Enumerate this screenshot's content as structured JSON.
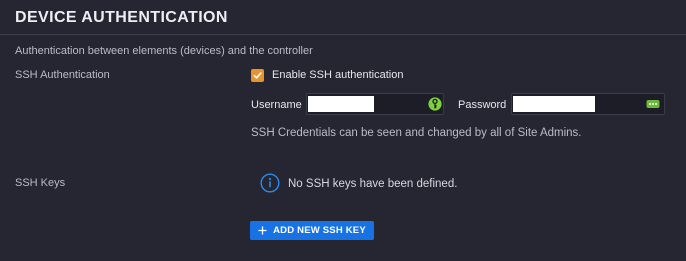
{
  "section": {
    "title": "DEVICE AUTHENTICATION",
    "subtitle": "Authentication between elements (devices) and the controller"
  },
  "ssh_auth": {
    "label": "SSH Authentication",
    "checkbox_label": "Enable SSH authentication",
    "checked": true,
    "checkbox_color": "#e8942c",
    "username_label": "Username",
    "username_value": "",
    "password_label": "Password",
    "password_value": "",
    "username_icon": "key-icon",
    "password_icon": "show-password-icon",
    "note": "SSH Credentials can be seen and changed by all of Site Admins."
  },
  "ssh_keys": {
    "label": "SSH Keys",
    "empty_text": "No SSH keys have been defined.",
    "info_icon": "info-icon",
    "add_button_label": "ADD NEW SSH KEY",
    "add_button_color": "#1773e3"
  }
}
